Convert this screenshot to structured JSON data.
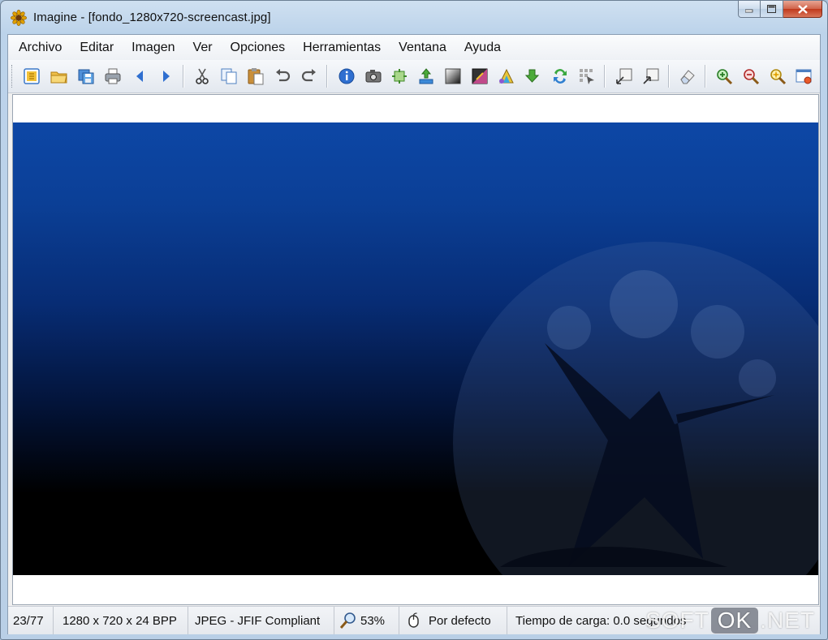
{
  "window": {
    "title": "Imagine - [fondo_1280x720-screencast.jpg]"
  },
  "menu": [
    {
      "label": "Archivo"
    },
    {
      "label": "Editar"
    },
    {
      "label": "Imagen"
    },
    {
      "label": "Ver"
    },
    {
      "label": "Opciones"
    },
    {
      "label": "Herramientas"
    },
    {
      "label": "Ventana"
    },
    {
      "label": "Ayuda"
    }
  ],
  "toolbar": {
    "icons": [
      "browse-icon",
      "open-folder-icon",
      "save-icon",
      "print-icon",
      "previous-icon",
      "next-icon",
      "cut-icon",
      "copy-icon",
      "paste-icon",
      "undo-icon",
      "redo-icon",
      "info-icon",
      "capture-icon",
      "resize-icon",
      "flip-icon",
      "grayscale-icon",
      "color-adjust-icon",
      "effects-icon",
      "rotate-icon",
      "convert-icon",
      "batch-icon",
      "fit-window-icon",
      "actual-size-icon",
      "eraser-icon",
      "zoom-in-icon",
      "zoom-out-icon",
      "magic-icon",
      "fullscreen-icon"
    ]
  },
  "status": {
    "page": "23/77",
    "dimensions": "1280 x 720 x 24 BPP",
    "format": "JPEG - JFIF Compliant",
    "zoom": "53%",
    "mouse_mode": "Por defecto",
    "load_time": "Tiempo de carga: 0.0 segundos"
  },
  "watermark": {
    "part1": "SOFT",
    "part2": "OK",
    "part3": ".NET"
  },
  "colors": {
    "image_top": "#0d47a6",
    "image_bottom": "#000000",
    "close_button": "#c0391c"
  }
}
